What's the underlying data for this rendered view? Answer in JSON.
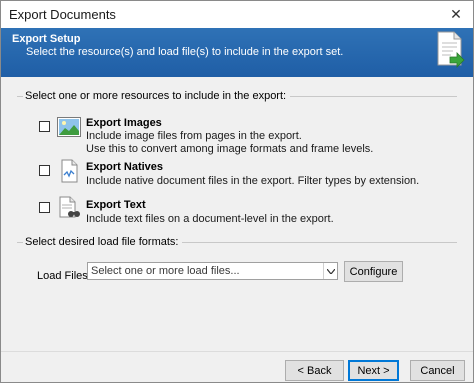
{
  "window": {
    "title": "Export Documents",
    "close_glyph": "✕"
  },
  "banner": {
    "title": "Export Setup",
    "subtitle": "Select the resource(s) and load file(s) to include in the export set.",
    "icon": "export-document-icon"
  },
  "resources_group": {
    "label": "Select one or more resources to include in the export:"
  },
  "options": [
    {
      "title": "Export Images",
      "desc_lines": [
        "Include image files from pages in the export.",
        "Use this to convert among image formats and frame levels."
      ],
      "icon": "image-icon",
      "checked": false
    },
    {
      "title": "Export Natives",
      "desc_lines": [
        "Include native document files in the export. Filter types by extension."
      ],
      "icon": "native-document-icon",
      "checked": false
    },
    {
      "title": "Export Text",
      "desc_lines": [
        "Include text files on a document-level in the export."
      ],
      "icon": "text-search-icon",
      "checked": false
    }
  ],
  "loadfile_group": {
    "label": "Select desired load file formats:"
  },
  "load_files": {
    "label": "Load Files:",
    "placeholder": "Select one or more load files...",
    "configure_label": "Configure"
  },
  "footer": {
    "back_label": "< Back",
    "next_label": "Next >",
    "cancel_label": "Cancel"
  },
  "colors": {
    "banner": "#2566ae",
    "accent": "#0078d7"
  }
}
